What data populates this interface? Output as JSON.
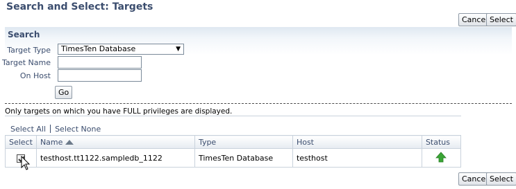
{
  "page": {
    "title": "Search and Select: Targets"
  },
  "actions": {
    "cancel_label": "Cancel",
    "select_label": "Select"
  },
  "search": {
    "heading": "Search",
    "target_type": {
      "label": "Target Type",
      "value": "TimesTen Database"
    },
    "target_name": {
      "label": "Target Name",
      "value": ""
    },
    "on_host": {
      "label": "On Host",
      "value": ""
    },
    "go_label": "Go"
  },
  "note": "Only targets on which you have FULL privileges are displayed.",
  "selection_links": {
    "select_all": "Select All",
    "select_none": "Select None"
  },
  "table": {
    "headers": {
      "select": "Select",
      "name": "Name",
      "type": "Type",
      "host": "Host",
      "status": "Status"
    },
    "rows": [
      {
        "checked": true,
        "name": "testhost.tt1122.sampledb_1122",
        "type": "TimesTen Database",
        "host": "testhost",
        "status": "up"
      }
    ]
  },
  "icons": {
    "status_up": "status-up-arrow-icon",
    "sort": "sort-ascending-icon"
  },
  "colors": {
    "heading": "#3b4d6e",
    "status_up": "#3aa535"
  }
}
